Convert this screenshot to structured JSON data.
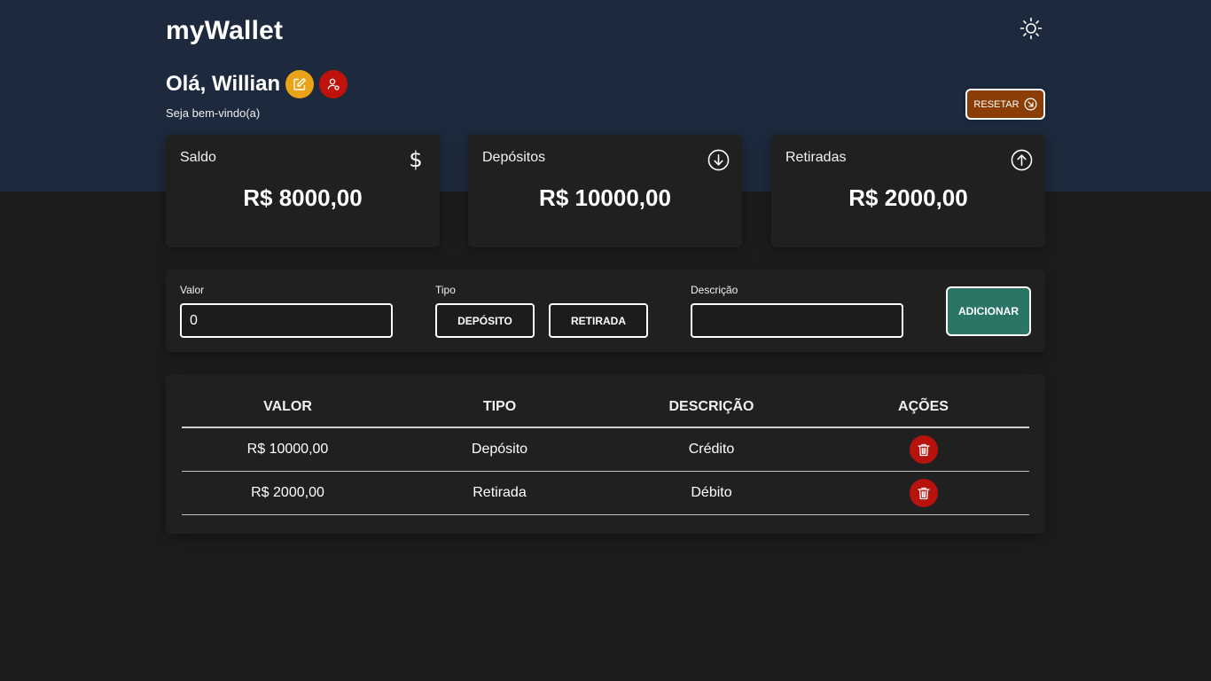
{
  "app": {
    "title": "myWallet"
  },
  "header": {
    "greeting": "Olá, Willian",
    "welcome": "Seja bem-vindo(a)",
    "reset_label": "RESETAR"
  },
  "cards": [
    {
      "title": "Saldo",
      "value": "R$ 8000,00",
      "icon": "dollar-icon"
    },
    {
      "title": "Depósitos",
      "value": "R$ 10000,00",
      "icon": "arrow-down-circle-icon"
    },
    {
      "title": "Retiradas",
      "value": "R$ 2000,00",
      "icon": "arrow-up-circle-icon"
    }
  ],
  "form": {
    "valor_label": "Valor",
    "valor_value": "0",
    "tipo_label": "Tipo",
    "deposito_label": "DEPÓSITO",
    "retirada_label": "RETIRADA",
    "descricao_label": "Descrição",
    "descricao_value": "",
    "add_label": "ADICIONAR"
  },
  "table": {
    "headers": [
      "VALOR",
      "TIPO",
      "DESCRIÇÃO",
      "AÇÕES"
    ],
    "rows": [
      {
        "valor": "R$ 10000,00",
        "tipo": "Depósito",
        "descricao": "Crédito"
      },
      {
        "valor": "R$ 2000,00",
        "tipo": "Retirada",
        "descricao": "Débito"
      }
    ]
  },
  "colors": {
    "header_bg": "#1d2a3d",
    "page_bg": "#1c1c1c",
    "panel_bg": "#202020",
    "edit_yellow": "#e8a317",
    "danger_red": "#c0120c",
    "reset_brown": "#8a3e06",
    "add_green": "#2a7565"
  }
}
